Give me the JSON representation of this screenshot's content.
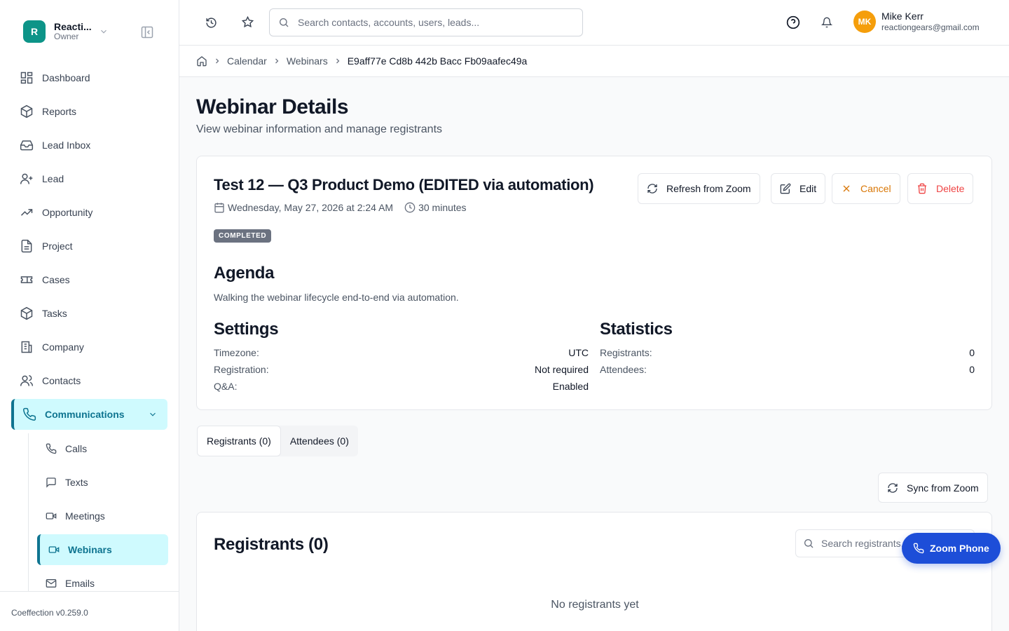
{
  "sidebar": {
    "org_initial": "R",
    "org_name": "Reacti...",
    "org_role": "Owner",
    "nav": [
      {
        "label": "Dashboard",
        "icon": "dashboard-icon"
      },
      {
        "label": "Reports",
        "icon": "cube-icon"
      },
      {
        "label": "Lead Inbox",
        "icon": "inbox-icon"
      },
      {
        "label": "Lead",
        "icon": "user-plus-icon"
      },
      {
        "label": "Opportunity",
        "icon": "trending-up-icon"
      },
      {
        "label": "Project",
        "icon": "document-icon"
      },
      {
        "label": "Cases",
        "icon": "ticket-icon"
      },
      {
        "label": "Tasks",
        "icon": "cube-icon"
      },
      {
        "label": "Company",
        "icon": "building-icon"
      },
      {
        "label": "Contacts",
        "icon": "users-icon"
      },
      {
        "label": "Communications",
        "icon": "phone-icon"
      }
    ],
    "subnav": [
      {
        "label": "Calls",
        "icon": "phone-icon"
      },
      {
        "label": "Texts",
        "icon": "message-icon"
      },
      {
        "label": "Meetings",
        "icon": "video-icon"
      },
      {
        "label": "Webinars",
        "icon": "video-icon"
      },
      {
        "label": "Emails",
        "icon": "mail-icon"
      }
    ],
    "version": "Coeffection v0.259.0"
  },
  "topbar": {
    "search_placeholder": "Search contacts, accounts, users, leads...",
    "user_initials": "MK",
    "user_name": "Mike Kerr",
    "user_email": "reactiongears@gmail.com"
  },
  "breadcrumb": [
    "Calendar",
    "Webinars",
    "E9aff77e Cd8b 442b Bacc Fb09aafec49a"
  ],
  "page": {
    "title": "Webinar Details",
    "subtitle": "View webinar information and manage registrants"
  },
  "webinar": {
    "title": "Test 12 — Q3 Product Demo (EDITED via automation)",
    "date": "Wednesday, May 27, 2026 at 2:24 AM",
    "duration": "30 minutes",
    "status": "COMPLETED",
    "buttons": {
      "refresh": "Refresh from Zoom",
      "edit": "Edit",
      "cancel": "Cancel",
      "delete": "Delete"
    },
    "agenda_heading": "Agenda",
    "agenda_text": "Walking the webinar lifecycle end-to-end via automation.",
    "settings_heading": "Settings",
    "settings": [
      {
        "k": "Timezone:",
        "v": "UTC"
      },
      {
        "k": "Registration:",
        "v": "Not required"
      },
      {
        "k": "Q&A:",
        "v": "Enabled"
      }
    ],
    "statistics_heading": "Statistics",
    "statistics": [
      {
        "k": "Registrants:",
        "v": "0"
      },
      {
        "k": "Attendees:",
        "v": "0"
      }
    ]
  },
  "tabs": [
    "Registrants (0)",
    "Attendees (0)"
  ],
  "sync_button": "Sync from Zoom",
  "registrants": {
    "title": "Registrants (0)",
    "search_placeholder": "Search registrants...",
    "empty": "No registrants yet"
  },
  "zoom_phone": "Zoom Phone",
  "colors": {
    "accent": "#0e7490",
    "accent_bg": "#cffafe",
    "fab": "#1d4ed8",
    "cancel": "#d97706",
    "delete": "#ef4444"
  }
}
